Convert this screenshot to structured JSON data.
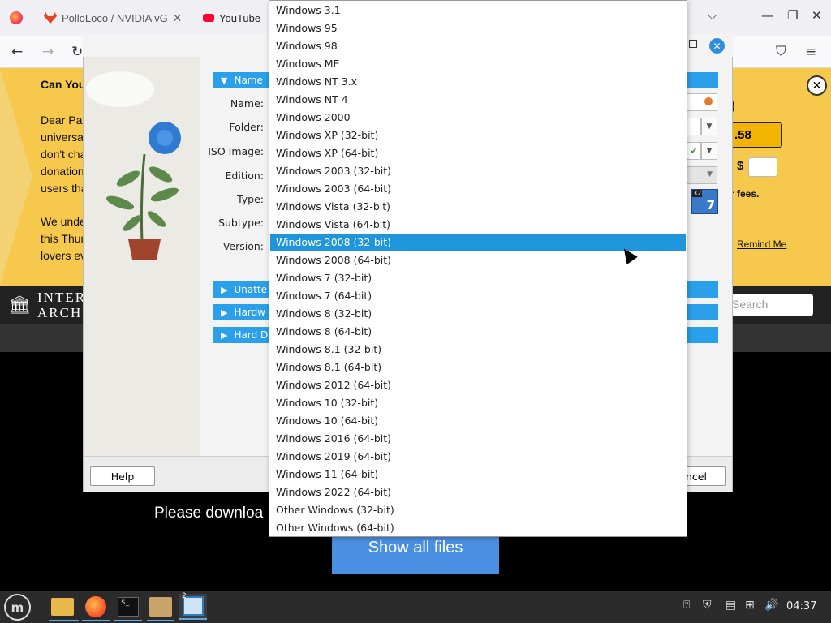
{
  "browser": {
    "tabs": [
      {
        "label": "PolloLoco / NVIDIA vG",
        "icon": "gitlab-icon"
      },
      {
        "label": "YouTube",
        "icon": "youtube-icon"
      }
    ]
  },
  "banner": {
    "heading": "Can You",
    "body_lines": [
      "Dear Pat",
      "universa",
      "don't cha",
      "donation",
      "users tha"
    ],
    "body2_lines": [
      "We unde",
      "this Thur",
      "lovers ev"
    ],
    "amount_partial": ")",
    "amount_selected": ".58",
    "custom_currency": "$",
    "fees_text": "r fees.",
    "remind_me": "Remind Me"
  },
  "archive": {
    "name_line1": "INTER",
    "name_line2": "ARCHI",
    "search_placeholder": "Search",
    "download_text": "Please downloa",
    "show_all_files": "Show all files"
  },
  "dialog": {
    "sections": {
      "name": "Name",
      "unattended": "Unatte",
      "hardware": "Hardw",
      "hard_disk": "Hard D"
    },
    "labels": {
      "name": "Name:",
      "folder": "Folder:",
      "iso_image": "ISO Image:",
      "edition": "Edition:",
      "type": "Type:",
      "subtype": "Subtype:",
      "version": "Version:"
    },
    "os_badge": "7",
    "os_badge_small": "32",
    "help_button": "Help",
    "cancel_button": "ncel"
  },
  "version_list": {
    "items": [
      "Windows 3.1",
      "Windows 95",
      "Windows 98",
      "Windows ME",
      "Windows NT 3.x",
      "Windows NT 4",
      "Windows 2000",
      "Windows XP (32-bit)",
      "Windows XP (64-bit)",
      "Windows 2003 (32-bit)",
      "Windows 2003 (64-bit)",
      "Windows Vista (32-bit)",
      "Windows Vista (64-bit)",
      "Windows 2008 (32-bit)",
      "Windows 2008 (64-bit)",
      "Windows 7 (32-bit)",
      "Windows 7 (64-bit)",
      "Windows 8 (32-bit)",
      "Windows 8 (64-bit)",
      "Windows 8.1 (32-bit)",
      "Windows 8.1 (64-bit)",
      "Windows 2012 (64-bit)",
      "Windows 10 (32-bit)",
      "Windows 10 (64-bit)",
      "Windows 2016 (64-bit)",
      "Windows 2019 (64-bit)",
      "Windows 11 (64-bit)",
      "Windows 2022 (64-bit)",
      "Other Windows (32-bit)",
      "Other Windows (64-bit)"
    ],
    "selected": "Windows 2008 (32-bit)"
  },
  "taskbar": {
    "clock": "04:37",
    "workspace_badge": "2"
  },
  "colors": {
    "accent": "#29a0e9",
    "selected": "#1f96dc",
    "banner": "#f6c84b"
  }
}
